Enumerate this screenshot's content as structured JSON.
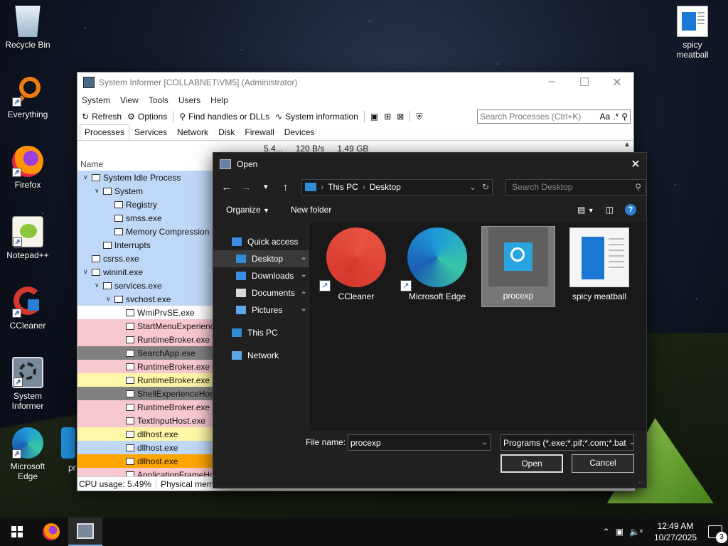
{
  "desktop": {
    "icons": [
      {
        "label": "Recycle Bin"
      },
      {
        "label": "Everything"
      },
      {
        "label": "Firefox"
      },
      {
        "label": "Notepad++"
      },
      {
        "label": "CCleaner"
      },
      {
        "label": "System Informer"
      },
      {
        "label": "Microsoft Edge"
      },
      {
        "label": "spicy meatball"
      }
    ],
    "partial_icon_label": "pr"
  },
  "system_informer": {
    "title": "System Informer [COLLABNET\\VM5] (Administrator)",
    "menu": [
      "System",
      "View",
      "Tools",
      "Users",
      "Help"
    ],
    "toolbar": {
      "refresh": "Refresh",
      "options": "Options",
      "find_handles": "Find handles or DLLs",
      "system_information": "System information",
      "search_placeholder": "Search Processes (Ctrl+K)",
      "search_opt_case": "Aa",
      "search_opt_regex": ".*"
    },
    "tabs": [
      "Processes",
      "Services",
      "Network",
      "Disk",
      "Firewall",
      "Devices"
    ],
    "column_name": "Name",
    "stats": [
      "5.4...",
      "120 B/s",
      "1.49 GB"
    ],
    "processes": [
      {
        "name": "System Idle Process",
        "indent": 0,
        "twisty": "v",
        "bg": "#c0d8f8"
      },
      {
        "name": "System",
        "indent": 1,
        "twisty": "v",
        "bg": "#c0d8f8"
      },
      {
        "name": "Registry",
        "indent": 2,
        "twisty": "",
        "bg": "#c0d8f8"
      },
      {
        "name": "smss.exe",
        "indent": 2,
        "twisty": "",
        "bg": "#c0d8f8"
      },
      {
        "name": "Memory Compression",
        "indent": 2,
        "twisty": "",
        "bg": "#c0d8f8"
      },
      {
        "name": "Interrupts",
        "indent": 1,
        "twisty": "",
        "bg": "#c0d8f8"
      },
      {
        "name": "csrss.exe",
        "indent": 0,
        "twisty": "",
        "bg": "#c0d8f8"
      },
      {
        "name": "wininit.exe",
        "indent": 0,
        "twisty": "v",
        "bg": "#c0d8f8"
      },
      {
        "name": "services.exe",
        "indent": 1,
        "twisty": "v",
        "bg": "#c0d8f8"
      },
      {
        "name": "svchost.exe",
        "indent": 2,
        "twisty": "v",
        "bg": "#c0d8f8"
      },
      {
        "name": "WmiPrvSE.exe",
        "indent": 3,
        "twisty": "",
        "bg": "#ffffff"
      },
      {
        "name": "StartMenuExperienceHost.exe",
        "indent": 3,
        "twisty": "",
        "bg": "#f8c8d0"
      },
      {
        "name": "RuntimeBroker.exe",
        "indent": 3,
        "twisty": "",
        "bg": "#f8c8d0"
      },
      {
        "name": "SearchApp.exe",
        "indent": 3,
        "twisty": "",
        "bg": "#808080"
      },
      {
        "name": "RuntimeBroker.exe",
        "indent": 3,
        "twisty": "",
        "bg": "#f8c8d0"
      },
      {
        "name": "RuntimeBroker.exe",
        "indent": 3,
        "twisty": "",
        "bg": "#fff7a8"
      },
      {
        "name": "ShellExperienceHost.exe",
        "indent": 3,
        "twisty": "",
        "bg": "#808080"
      },
      {
        "name": "RuntimeBroker.exe",
        "indent": 3,
        "twisty": "",
        "bg": "#f8c8d0"
      },
      {
        "name": "TextInputHost.exe",
        "indent": 3,
        "twisty": "",
        "bg": "#f8c8d0"
      },
      {
        "name": "dllhost.exe",
        "indent": 3,
        "twisty": "",
        "bg": "#fff7a8"
      },
      {
        "name": "dllhost.exe",
        "indent": 3,
        "twisty": "",
        "bg": "#c0d8f8"
      },
      {
        "name": "dllhost.exe",
        "indent": 3,
        "twisty": "",
        "bg": "#ffa500"
      },
      {
        "name": "ApplicationFrameHost.exe",
        "indent": 3,
        "twisty": "",
        "bg": "#f8c8d0"
      }
    ],
    "status": {
      "cpu": "CPU usage: 5.49%",
      "memory": "Physical memory"
    }
  },
  "open_dialog": {
    "title": "Open",
    "breadcrumb": [
      "This PC",
      "Desktop"
    ],
    "search_placeholder": "Search Desktop",
    "commands": {
      "organize": "Organize",
      "new_folder": "New folder"
    },
    "nav": [
      {
        "label": "Quick access",
        "sub": false,
        "pin": false,
        "selected": false,
        "icon_color": "#3a8ee6"
      },
      {
        "label": "Desktop",
        "sub": true,
        "pin": true,
        "selected": true,
        "icon_color": "#2f8cd6"
      },
      {
        "label": "Downloads",
        "sub": true,
        "pin": true,
        "selected": false,
        "icon_color": "#3a8ee6"
      },
      {
        "label": "Documents",
        "sub": true,
        "pin": true,
        "selected": false,
        "icon_color": "#d9d9d9"
      },
      {
        "label": "Pictures",
        "sub": true,
        "pin": true,
        "selected": false,
        "icon_color": "#5ea6e6"
      },
      {
        "label": "This PC",
        "sub": false,
        "pin": false,
        "selected": false,
        "icon_color": "#2f8cd6"
      },
      {
        "label": "Network",
        "sub": false,
        "pin": false,
        "selected": false,
        "icon_color": "#5ea6e6"
      }
    ],
    "files": [
      {
        "name": "CCleaner",
        "shortcut": true,
        "selected": false
      },
      {
        "name": "Microsoft Edge",
        "shortcut": true,
        "selected": false
      },
      {
        "name": "procexp",
        "shortcut": false,
        "selected": true
      },
      {
        "name": "spicy meatball",
        "shortcut": false,
        "selected": false
      }
    ],
    "file_name_label": "File name:",
    "file_name_value": "procexp",
    "file_type": "Programs (*.exe;*.pif;*.com;*.bat",
    "open_label": "Open",
    "cancel_label": "Cancel"
  },
  "taskbar": {
    "time": "12:49 AM",
    "date": "10/27/2025",
    "notification_count": "3"
  }
}
